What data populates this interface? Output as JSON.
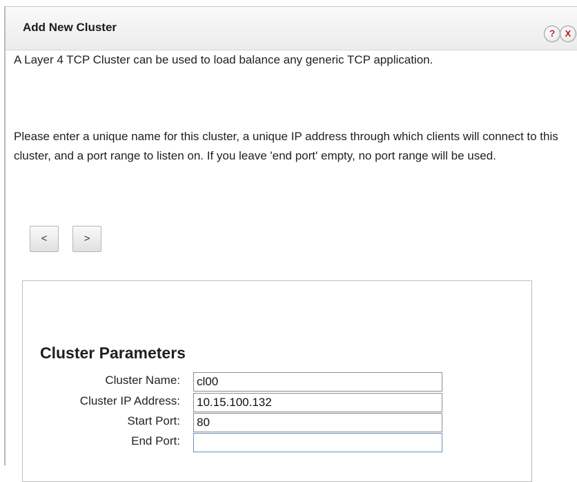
{
  "dialog": {
    "title": "Add New Cluster",
    "help_icon": "?",
    "close_icon": "X"
  },
  "description": {
    "paragraph1": "A Layer 4 TCP Cluster can be used to load balance any generic TCP application.",
    "paragraph2": "Please enter a unique name for this cluster, a unique IP address through which clients will connect to this cluster, and a port range to listen on. If you leave 'end port' empty, no port range will be used."
  },
  "navigation": {
    "prev_label": "<",
    "next_label": ">"
  },
  "params": {
    "title": "Cluster Parameters",
    "fields": [
      {
        "label": "Cluster Name:",
        "value": "cl00"
      },
      {
        "label": "Cluster IP Address:",
        "value": "10.15.100.132"
      },
      {
        "label": "Start Port:",
        "value": "80"
      },
      {
        "label": "End Port:",
        "value": ""
      }
    ]
  }
}
